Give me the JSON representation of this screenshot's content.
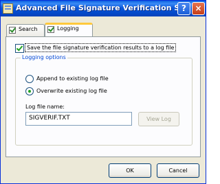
{
  "window": {
    "title": "Advanced File Signature Verification Setti...",
    "help_label": "?",
    "close_label": "×"
  },
  "tabs": [
    {
      "label": "Search",
      "selected": false
    },
    {
      "label": "Logging",
      "selected": true
    }
  ],
  "logging": {
    "save_checkbox": {
      "label": "Save the file signature verification results to a log file",
      "checked": true
    },
    "group_title": "Logging options",
    "options": [
      {
        "label": "Append to existing log file",
        "selected": false
      },
      {
        "label": "Overwrite existing log file",
        "selected": true
      }
    ],
    "filename_label": "Log file name:",
    "filename_value": "SIGVERIF.TXT",
    "view_log_label": "View Log"
  },
  "buttons": {
    "ok": "OK",
    "cancel": "Cancel"
  }
}
